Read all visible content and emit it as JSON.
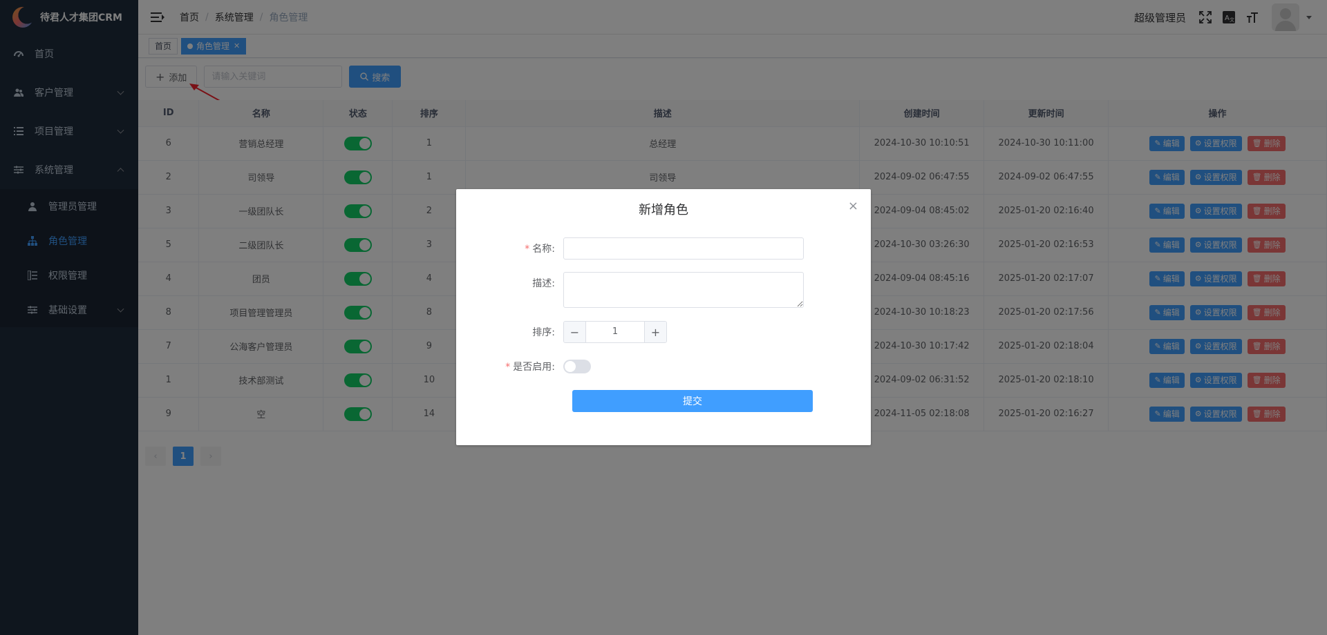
{
  "app": {
    "title": "待君人才集团CRM"
  },
  "sidebar": {
    "items": [
      {
        "label": "首页",
        "icon": "dashboard-icon"
      },
      {
        "label": "客户管理",
        "icon": "users-icon"
      },
      {
        "label": "项目管理",
        "icon": "list-icon"
      },
      {
        "label": "系统管理",
        "icon": "sliders-icon"
      }
    ],
    "submenu": [
      {
        "label": "管理员管理",
        "icon": "user-icon"
      },
      {
        "label": "角色管理",
        "icon": "org-tree-icon"
      },
      {
        "label": "权限管理",
        "icon": "tree-table-icon"
      },
      {
        "label": "基础设置",
        "icon": "sliders-icon"
      }
    ]
  },
  "header": {
    "breadcrumb": [
      "首页",
      "系统管理",
      "角色管理"
    ],
    "user": "超级管理员"
  },
  "tags": {
    "home": "首页",
    "active": "角色管理"
  },
  "toolbar": {
    "add_label": "添加",
    "search_placeholder": "请输入关键词",
    "search_label": "搜索"
  },
  "table": {
    "headers": [
      "ID",
      "名称",
      "状态",
      "排序",
      "描述",
      "创建时间",
      "更新时间",
      "操作"
    ],
    "actions": {
      "edit": "编辑",
      "perm": "设置权限",
      "delete": "删除"
    },
    "rows": [
      {
        "id": "6",
        "name": "营销总经理",
        "status": true,
        "sort": "1",
        "desc": "总经理",
        "created": "2024-10-30 10:10:51",
        "updated": "2024-10-30 10:11:00"
      },
      {
        "id": "2",
        "name": "司领导",
        "status": true,
        "sort": "1",
        "desc": "司领导",
        "created": "2024-09-02 06:47:55",
        "updated": "2024-09-02 06:47:55"
      },
      {
        "id": "3",
        "name": "一级团队长",
        "status": true,
        "sort": "2",
        "desc": "",
        "created": "2024-09-04 08:45:02",
        "updated": "2025-01-20 02:16:40"
      },
      {
        "id": "5",
        "name": "二级团队长",
        "status": true,
        "sort": "3",
        "desc": "",
        "created": "2024-10-30 03:26:30",
        "updated": "2025-01-20 02:16:53"
      },
      {
        "id": "4",
        "name": "团员",
        "status": true,
        "sort": "4",
        "desc": "",
        "created": "2024-09-04 08:45:16",
        "updated": "2025-01-20 02:17:07"
      },
      {
        "id": "8",
        "name": "项目管理管理员",
        "status": true,
        "sort": "8",
        "desc": "",
        "created": "2024-10-30 10:18:23",
        "updated": "2025-01-20 02:17:56"
      },
      {
        "id": "7",
        "name": "公海客户管理员",
        "status": true,
        "sort": "9",
        "desc": "",
        "created": "2024-10-30 10:17:42",
        "updated": "2025-01-20 02:18:04"
      },
      {
        "id": "1",
        "name": "技术部测试",
        "status": true,
        "sort": "10",
        "desc": "",
        "created": "2024-09-02 06:31:52",
        "updated": "2025-01-20 02:18:10"
      },
      {
        "id": "9",
        "name": "空",
        "status": true,
        "sort": "14",
        "desc": "",
        "created": "2024-11-05 02:18:08",
        "updated": "2025-01-20 02:16:27"
      }
    ]
  },
  "pager": {
    "current": "1",
    "prev": "‹",
    "next": "›"
  },
  "dialog": {
    "title": "新增角色",
    "close": "×",
    "name_label": "名称:",
    "desc_label": "描述:",
    "sort_label": "排序:",
    "sort_value": "1",
    "enabled_label": "是否启用:",
    "enabled": false,
    "submit_label": "提交"
  },
  "colors": {
    "primary": "#409eff",
    "danger": "#f56c6c",
    "switch_on": "#13ce66",
    "sidebar_bg": "#1f2d3d"
  }
}
